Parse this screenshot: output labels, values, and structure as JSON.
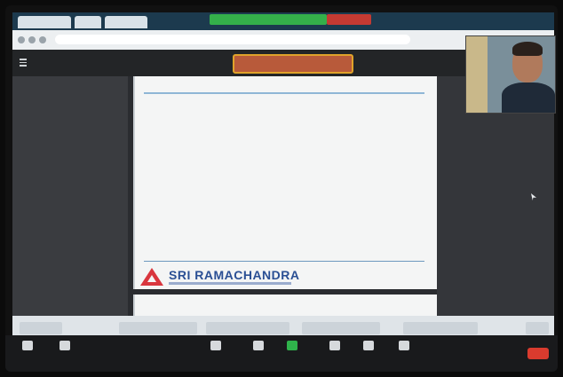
{
  "colors": {
    "share_green": "#34b04a",
    "end_red": "#d93b2e",
    "doc_title_border": "#e0a32a",
    "logo_red": "#d9363e",
    "logo_blue": "#2a4f94"
  },
  "slide": {
    "logo_text": "SRI RAMACHANDRA",
    "bullets": [],
    "answers": []
  },
  "toolbar": {
    "items": [
      {
        "icon": "microphone-icon"
      },
      {
        "icon": "video-camera-icon"
      },
      {
        "icon": "participants-icon"
      },
      {
        "icon": "chat-icon"
      },
      {
        "icon": "share-screen-icon"
      },
      {
        "icon": "record-icon"
      },
      {
        "icon": "reactions-icon"
      },
      {
        "icon": "more-icon"
      }
    ]
  }
}
